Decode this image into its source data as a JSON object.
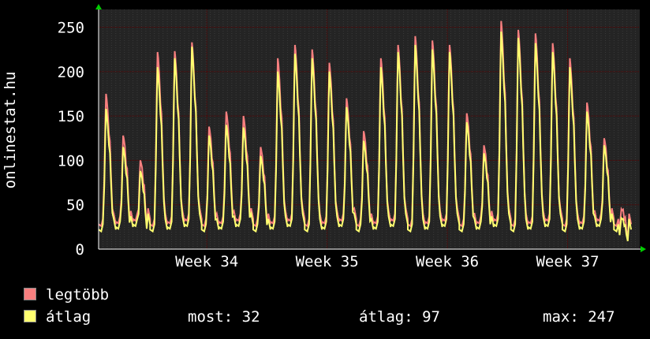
{
  "chart_data": {
    "type": "line",
    "ylabel": "onlinestat.hu",
    "ylim": [
      0,
      270
    ],
    "yticks": [
      0,
      50,
      100,
      150,
      200,
      250
    ],
    "x_tick_labels": [
      "Week 34",
      "Week 35",
      "Week 36",
      "Week 37"
    ],
    "x_tick_days": [
      6.3,
      13.3,
      20.3,
      27.3
    ],
    "xlim_days": [
      0,
      31.5
    ],
    "grid": true,
    "legend_position": "bottom-left",
    "daily_peaks": [
      {
        "day": 0.5,
        "max": 175,
        "avg": 158
      },
      {
        "day": 1.5,
        "max": 128,
        "avg": 115
      },
      {
        "day": 2.5,
        "max": 100,
        "avg": 88
      },
      {
        "day": 3.5,
        "max": 222,
        "avg": 205
      },
      {
        "day": 4.5,
        "max": 223,
        "avg": 215
      },
      {
        "day": 5.5,
        "max": 233,
        "avg": 228
      },
      {
        "day": 6.5,
        "max": 138,
        "avg": 128
      },
      {
        "day": 7.5,
        "max": 155,
        "avg": 140
      },
      {
        "day": 8.5,
        "max": 150,
        "avg": 137
      },
      {
        "day": 9.5,
        "max": 115,
        "avg": 105
      },
      {
        "day": 10.5,
        "max": 215,
        "avg": 200
      },
      {
        "day": 11.5,
        "max": 230,
        "avg": 220
      },
      {
        "day": 12.5,
        "max": 225,
        "avg": 215
      },
      {
        "day": 13.5,
        "max": 210,
        "avg": 200
      },
      {
        "day": 14.5,
        "max": 170,
        "avg": 160
      },
      {
        "day": 15.5,
        "max": 133,
        "avg": 122
      },
      {
        "day": 16.5,
        "max": 215,
        "avg": 205
      },
      {
        "day": 17.5,
        "max": 230,
        "avg": 222
      },
      {
        "day": 18.5,
        "max": 240,
        "avg": 230
      },
      {
        "day": 19.5,
        "max": 235,
        "avg": 225
      },
      {
        "day": 20.5,
        "max": 230,
        "avg": 222
      },
      {
        "day": 21.5,
        "max": 153,
        "avg": 143
      },
      {
        "day": 22.5,
        "max": 117,
        "avg": 108
      },
      {
        "day": 23.5,
        "max": 257,
        "avg": 245
      },
      {
        "day": 24.5,
        "max": 247,
        "avg": 238
      },
      {
        "day": 25.5,
        "max": 243,
        "avg": 232
      },
      {
        "day": 26.5,
        "max": 232,
        "avg": 222
      },
      {
        "day": 27.5,
        "max": 215,
        "avg": 205
      },
      {
        "day": 28.5,
        "max": 165,
        "avg": 155
      },
      {
        "day": 29.5,
        "max": 125,
        "avg": 117
      },
      {
        "day": 30.5,
        "max": 45,
        "avg": 35
      }
    ],
    "series": [
      {
        "name": "legtöbb",
        "color": "#f77f7f",
        "value_key": "max"
      },
      {
        "name": "átlag",
        "color": "#ffff70",
        "value_key": "avg"
      }
    ]
  },
  "stats": {
    "current": "most: 32",
    "average": "átlag: 97",
    "max": "max: 247"
  },
  "colors": {
    "background": "#000000",
    "plot_background": "#242424",
    "grid": "#5a0000",
    "axis": "#ffffff",
    "arrow": "#00cc00"
  }
}
